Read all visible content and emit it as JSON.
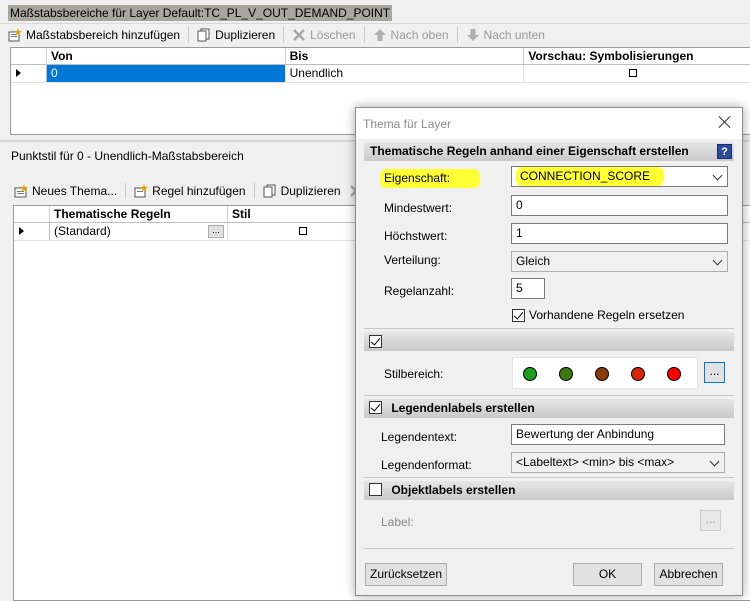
{
  "background": {
    "title": "Maßstabsbereiche für Layer Default:TC_PL_V_OUT_DEMAND_POINT",
    "toolbar1": {
      "add": "Maßstabsbereich hinzufügen",
      "duplicate": "Duplizieren",
      "delete": "Löschen",
      "up": "Nach oben",
      "down": "Nach unten"
    },
    "table1": {
      "headers": [
        "Von",
        "Bis",
        "Vorschau: Symbolisierungen"
      ],
      "rows": [
        {
          "from": "0",
          "to": "Unendlich"
        }
      ]
    },
    "point_style_label": "Punktstil für 0 - Unendlich-Maßstabsbereich",
    "toolbar2": {
      "new_theme": "Neues Thema...",
      "add_rule": "Regel hinzufügen",
      "duplicate": "Duplizieren"
    },
    "table2": {
      "headers": [
        "Thematische Regeln",
        "Stil"
      ],
      "rows": [
        {
          "rule": "(Standard)",
          "more": "..."
        }
      ]
    }
  },
  "dialog": {
    "title": "Thema für Layer",
    "section_rules": "Thematische Regeln anhand einer Eigenschaft erstellen",
    "help": "?",
    "property_label": "Eigenschaft:",
    "property_value": "CONNECTION_SCORE",
    "min_label": "Mindestwert:",
    "min_value": "0",
    "max_label": "Höchstwert:",
    "max_value": "1",
    "distribution_label": "Verteilung:",
    "distribution_value": "Gleich",
    "rule_count_label": "Regelanzahl:",
    "rule_count_value": "5",
    "replace_rules_label": "Vorhandene Regeln ersetzen",
    "style_range_label": "Stilbereich:",
    "style_more": "...",
    "swatch_colors": [
      "#1aa01a",
      "#3f7a10",
      "#8b3a0a",
      "#d9260a",
      "#ff0000"
    ],
    "section_legend": "Legendenlabels erstellen",
    "legend_text_label": "Legendentext:",
    "legend_text_value": "Bewertung der Anbindung",
    "legend_format_label": "Legendenformat:",
    "legend_format_value": "<Labeltext> <min> bis <max>",
    "section_object_labels": "Objektlabels erstellen",
    "label_label": "Label:",
    "label_more": "...",
    "reset_button": "Zurücksetzen",
    "ok_button": "OK",
    "cancel_button": "Abbrechen"
  }
}
